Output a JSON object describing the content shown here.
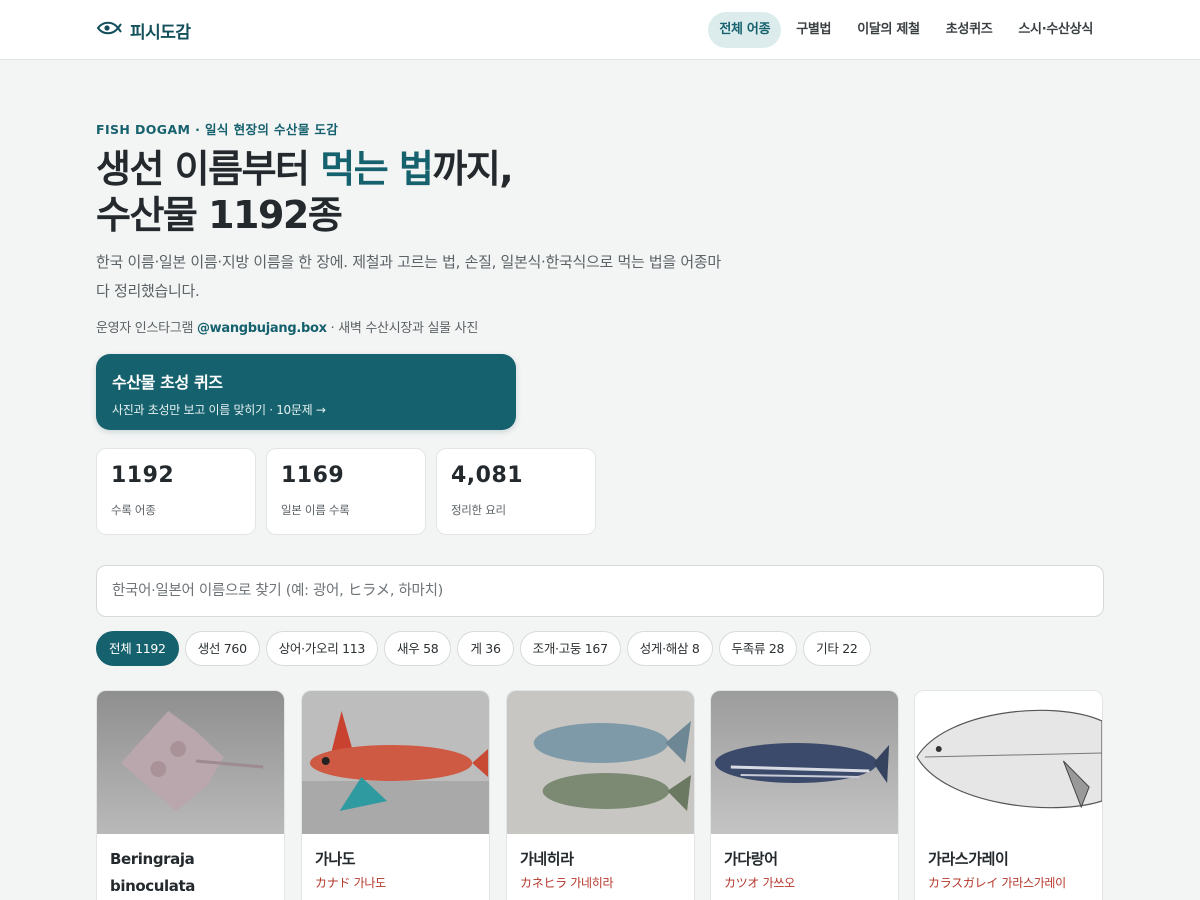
{
  "header": {
    "brand": "피시도감",
    "nav": [
      "전체 어종",
      "구별법",
      "이달의 제철",
      "초성퀴즈",
      "스시·수산상식"
    ],
    "active_index": 0
  },
  "hero": {
    "eyebrow": "FISH DOGAM · 일식 현장의 수산물 도감",
    "title_part1": "생선 이름부터 ",
    "title_accent": "먹는 법",
    "title_part2": "까지,",
    "title_line2": "수산물 1192종",
    "description": "한국 이름·일본 이름·지방 이름을 한 장에. 제철과 고르는 법, 손질, 일본식·한국식으로 먹는 법을 어종마다 정리했습니다.",
    "operator_prefix": "운영자 인스타그램 ",
    "operator_handle": "@wangbujang.box",
    "operator_suffix": " · 새벽 수산시장과 실물 사진"
  },
  "quiz": {
    "title": "수산물 초성 퀴즈",
    "subtitle": "사진과 초성만 보고 이름 맞히기 · 10문제 →"
  },
  "stats": [
    {
      "value": "1192",
      "label": "수록 어종"
    },
    {
      "value": "1169",
      "label": "일본 이름 수록"
    },
    {
      "value": "4,081",
      "label": "정리한 요리"
    }
  ],
  "search": {
    "placeholder": "한국어·일본어 이름으로 찾기 (예: 광어, ヒラメ, 하마치)",
    "value": ""
  },
  "filters": [
    "전체 1192",
    "생선 760",
    "상어·가오리 113",
    "새우 58",
    "게 36",
    "조개·고둥 167",
    "성게·해삼 8",
    "두족류 28",
    "기타 22"
  ],
  "filters_active_index": 0,
  "cards": [
    {
      "name": "Beringraja binoculata",
      "jp": "",
      "image": "skate-photo"
    },
    {
      "name": "가나도",
      "jp": "カナド 가나도",
      "image": "red-gurnard-photo"
    },
    {
      "name": "가네히라",
      "jp": "カネヒラ 가네히라",
      "image": "bitterling-photo"
    },
    {
      "name": "가다랑어",
      "jp": "カツオ 가쓰오",
      "image": "skipjack-photo"
    },
    {
      "name": "가라스가레이",
      "jp": "カラスガレイ 가라스가레이",
      "image": "flounder-illustration"
    }
  ],
  "colors": {
    "accent": "#15616d",
    "japanese_name": "#b5372b",
    "background": "#f3f4f4"
  }
}
